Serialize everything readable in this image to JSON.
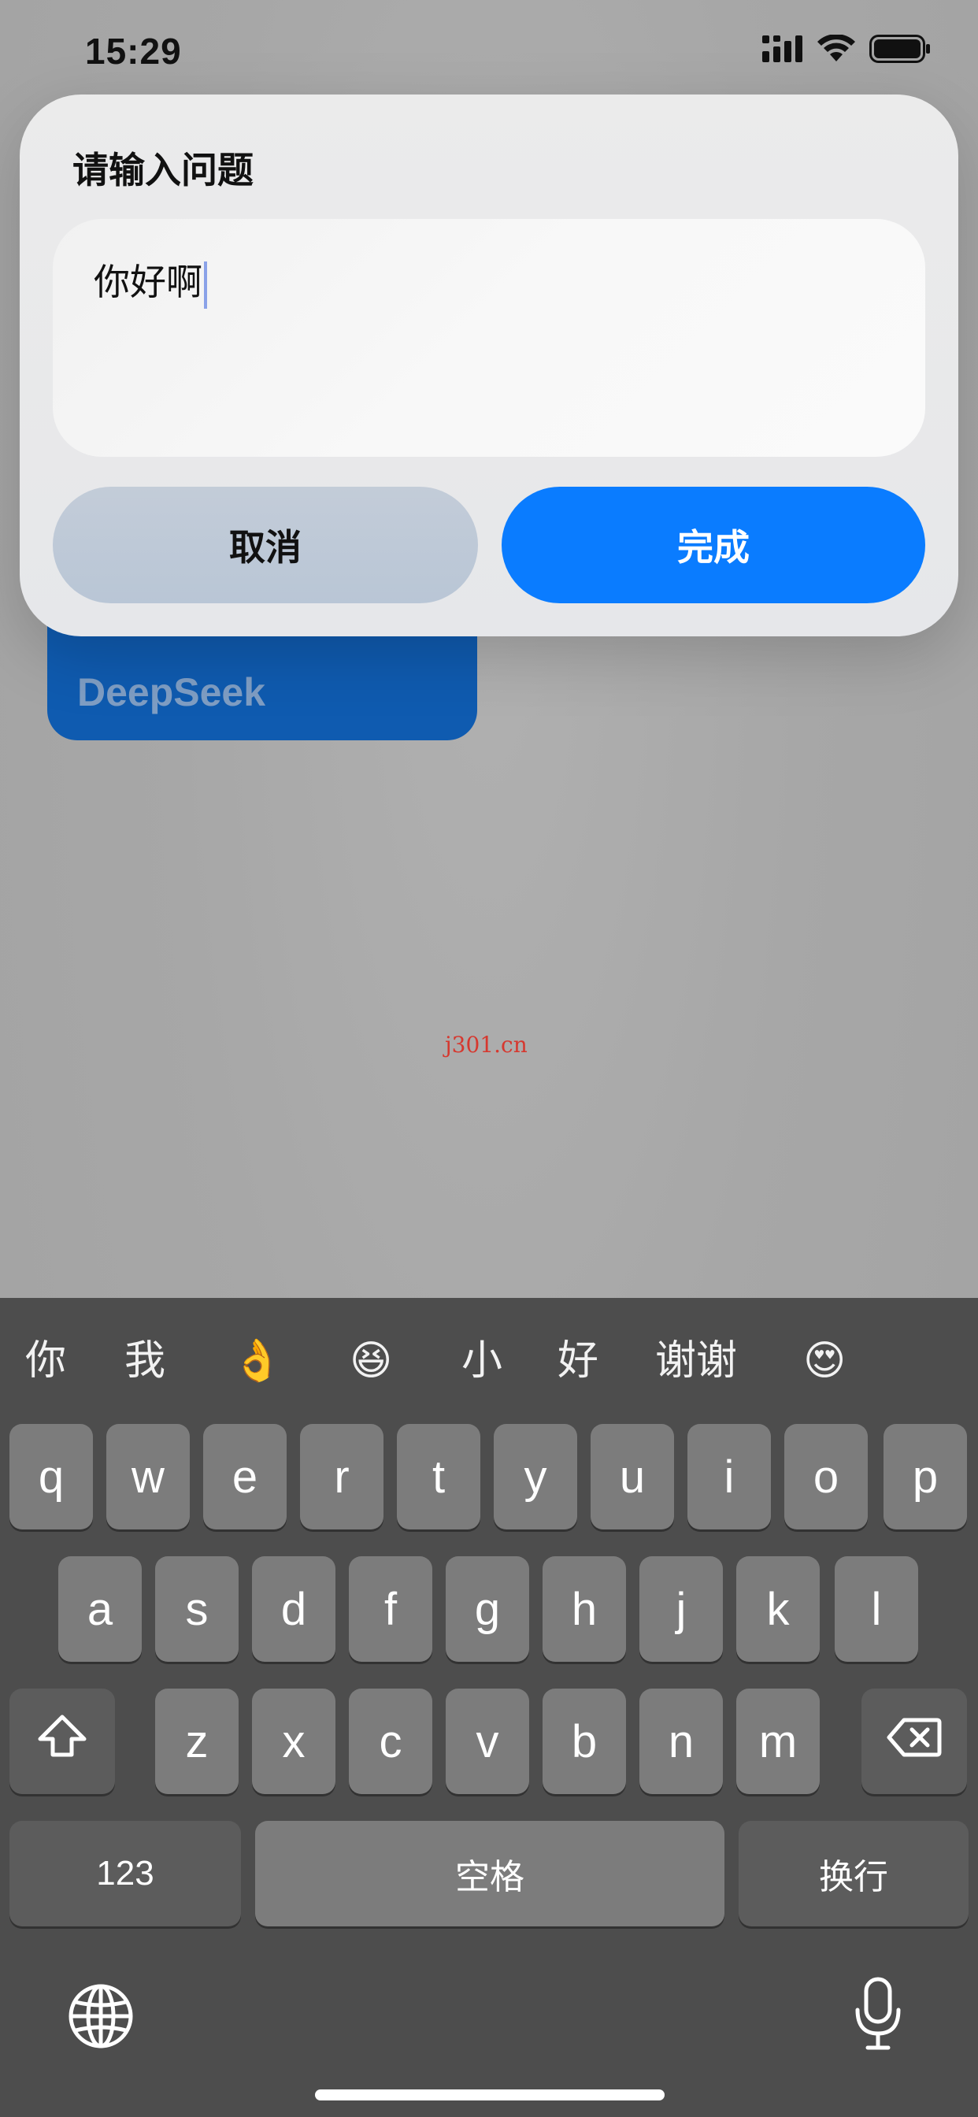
{
  "status_bar": {
    "time": "15:29"
  },
  "background_widget": {
    "label": "DeepSeek"
  },
  "dialog": {
    "title": "请输入问题",
    "input_value": "你好啊",
    "cancel_label": "取消",
    "done_label": "完成"
  },
  "watermark": "j301.cn",
  "keyboard": {
    "candidates": [
      "你",
      "我",
      "👌",
      "😆",
      "小",
      "好",
      "谢谢",
      "😍"
    ],
    "row1": [
      "q",
      "w",
      "e",
      "r",
      "t",
      "y",
      "u",
      "i",
      "o",
      "p"
    ],
    "row2": [
      "a",
      "s",
      "d",
      "f",
      "g",
      "h",
      "j",
      "k",
      "l"
    ],
    "row3": [
      "z",
      "x",
      "c",
      "v",
      "b",
      "n",
      "m"
    ],
    "numbers_label": "123",
    "space_label": "空格",
    "return_label": "换行"
  },
  "colors": {
    "accent": "#0a7cff",
    "widget": "#0f5bb0",
    "keyboard_bg": "#4d4d4d",
    "key": "#7c7c7c"
  },
  "icons": {
    "signal": "signal-icon",
    "wifi": "wifi-icon",
    "battery": "battery-icon",
    "shift": "shift-icon",
    "delete": "delete-icon",
    "globe": "globe-icon",
    "mic": "microphone-icon"
  }
}
